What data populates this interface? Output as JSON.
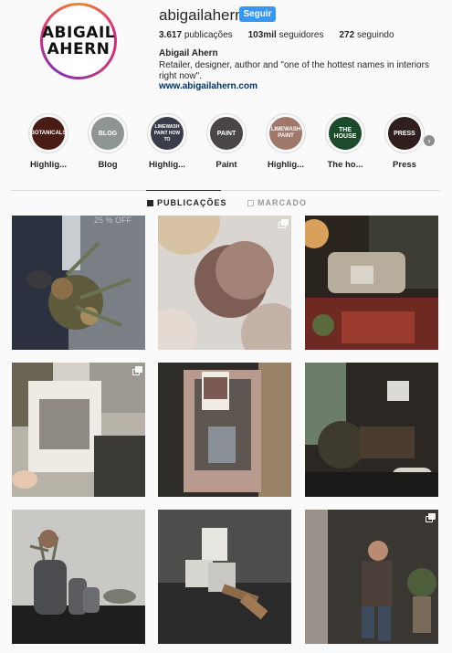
{
  "profile": {
    "avatar_line1": "ABIGAIL",
    "avatar_line2": "AHERN",
    "username": "abigailahern",
    "follow_label": "Seguir",
    "posts_count": "3.617",
    "posts_label": "publicações",
    "followers_count": "103mil",
    "followers_label": "seguidores",
    "following_count": "272",
    "following_label": "seguindo",
    "full_name": "Abigail Ahern",
    "bio": "Retailer, designer, author and \"one of the hottest names in interiors right now\".",
    "website": "www.abigailahern.com"
  },
  "highlights": [
    {
      "inner": "BOTANICALS",
      "label": "Highlig...",
      "color": "#4a1c16"
    },
    {
      "inner": "BLOG",
      "label": "Blog",
      "color": "#8f9593"
    },
    {
      "inner": "LIMEWASH PAINT HOW TO",
      "label": "Highlig...",
      "color": "#3a3c4a"
    },
    {
      "inner": "PAINT",
      "label": "Paint",
      "color": "#4a4648"
    },
    {
      "inner": "LIMEWASH PAINT",
      "label": "Highlig...",
      "color": "#a0786a"
    },
    {
      "inner": "THE HOUSE",
      "label": "The ho...",
      "color": "#1e4a2c"
    },
    {
      "inner": "PRESS",
      "label": "Press",
      "color": "#2e1f1e"
    }
  ],
  "tabs": {
    "posts": "PUBLICAÇÕES",
    "tagged": "MARCADO"
  },
  "posts": [
    {
      "name": "post-flower-bouquet",
      "overlay": "25 % OFF"
    },
    {
      "name": "post-paint-swatches"
    },
    {
      "name": "post-living-room"
    },
    {
      "name": "post-paint-samples"
    },
    {
      "name": "post-mirror-swatch"
    },
    {
      "name": "post-dark-lounge"
    },
    {
      "name": "post-vases"
    },
    {
      "name": "post-paint-tins"
    },
    {
      "name": "post-painting-wall"
    }
  ],
  "colors": {
    "follow_button": "#3897f0",
    "link": "#003569",
    "text": "#262626"
  }
}
